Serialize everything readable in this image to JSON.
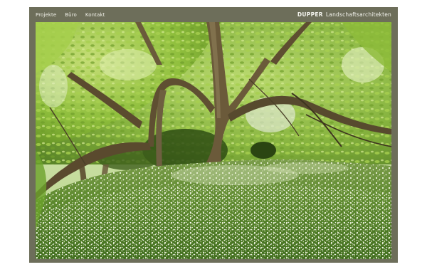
{
  "nav": {
    "items": [
      {
        "label": "Projekte"
      },
      {
        "label": "Büro"
      },
      {
        "label": "Kontakt"
      }
    ]
  },
  "brand": {
    "name_bold": "DUPPER",
    "name_rest": "Landschaftsarchitekten"
  },
  "photo": {
    "subject": "tree-canopy-with-wild-garlic-meadow"
  },
  "colors": {
    "frame": "#6d6e5a",
    "text": "#f2f2ea",
    "page_bg": "#ffffff"
  }
}
